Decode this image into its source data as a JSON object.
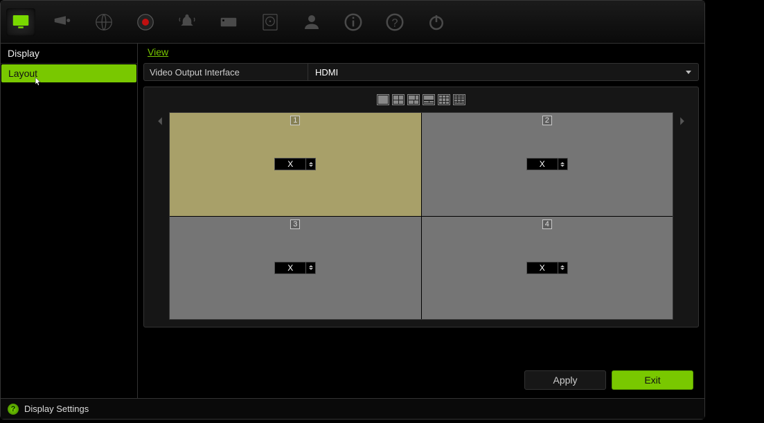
{
  "sidebar": {
    "header": "Display",
    "items": [
      {
        "label": "Layout",
        "active": true
      }
    ]
  },
  "tabs": [
    {
      "label": "View",
      "active": true
    }
  ],
  "video_output": {
    "label": "Video Output Interface",
    "value": "HDMI"
  },
  "layout_grid": {
    "cells": [
      {
        "index": "1",
        "value": "X",
        "selected": true
      },
      {
        "index": "2",
        "value": "X",
        "selected": false
      },
      {
        "index": "3",
        "value": "X",
        "selected": false
      },
      {
        "index": "4",
        "value": "X",
        "selected": false
      }
    ]
  },
  "buttons": {
    "apply": "Apply",
    "exit": "Exit"
  },
  "status": "Display Settings"
}
